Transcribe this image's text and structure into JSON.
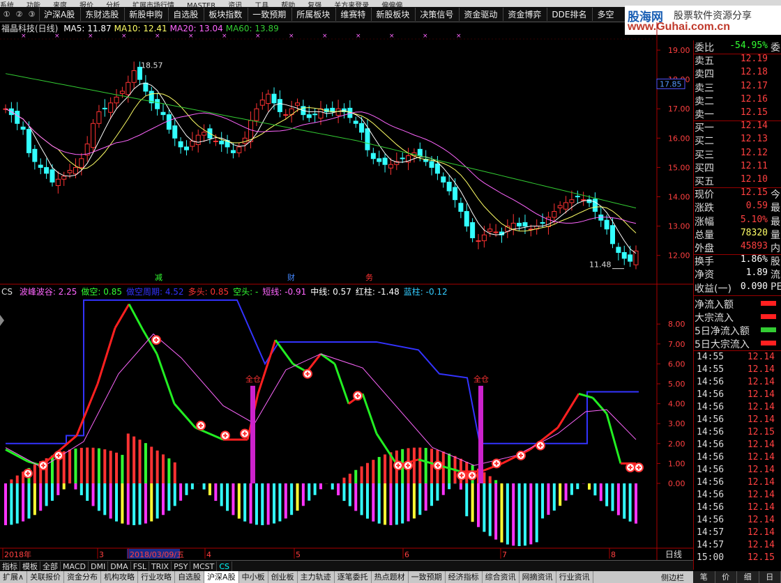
{
  "menu": [
    "系统",
    "功能",
    "来度",
    "报价",
    "分析",
    "扩展市场行情",
    "MASTER",
    "资讯",
    "工具",
    "帮助",
    "复强",
    "关方来登录",
    "偏偏偏"
  ],
  "toolbar": {
    "nums": [
      "①",
      "②",
      "③"
    ],
    "buttons": [
      "沪深A股",
      "东财选股",
      "新股申购",
      "自选股",
      "板块指数",
      "一致预期",
      "所属板块",
      "维赛特",
      "新股板块",
      "决策信号",
      "资金驱动",
      "资金博弈",
      "DDE排名",
      "多空"
    ]
  },
  "logo": {
    "name": "股海网",
    "tagline": "股票软件资源分享",
    "url": "www.Guhai.com.cn"
  },
  "price_panel": {
    "title": "福晶科技(日线)",
    "ma": [
      {
        "label": "MA5: 11.87",
        "color": "#ffffff"
      },
      {
        "label": "MA10: 12.41",
        "color": "#ffff66"
      },
      {
        "label": "MA20: 13.04",
        "color": "#ff66ff"
      },
      {
        "label": "MA60: 13.89",
        "color": "#33cc33"
      }
    ],
    "y_ticks": [
      "19.00",
      "18.00",
      "17.00",
      "16.00",
      "15.00",
      "14.00",
      "13.00",
      "12.00"
    ],
    "current_price_label": "17.85",
    "high_label": "18.57",
    "low_label": "11.48",
    "event_marks": [
      "减",
      "财",
      "务"
    ]
  },
  "indicator_panel": {
    "name": "CS",
    "items": [
      {
        "label": "波峰波谷: 2.25",
        "color": "#ff66ff"
      },
      {
        "label": "做空: 0.85",
        "color": "#33ff33"
      },
      {
        "label": "做空周期: 4.52",
        "color": "#3333ff"
      },
      {
        "label": "多头: 0.85",
        "color": "#ff3333"
      },
      {
        "label": "空头: -",
        "color": "#33ff33"
      },
      {
        "label": "短线: -0.91",
        "color": "#ff66ff"
      },
      {
        "label": "中线: 0.57",
        "color": "#ffffff"
      },
      {
        "label": "红柱: -1.48",
        "color": "#ffffff"
      },
      {
        "label": "蓝柱: -0.12",
        "color": "#33ccff"
      }
    ],
    "y_ticks": [
      "8.00",
      "7.00",
      "6.00",
      "5.00",
      "4.00",
      "3.00",
      "2.00",
      "1.00",
      "0.00"
    ],
    "signal_label": "全仓"
  },
  "date_axis": {
    "labels": [
      "2018年",
      "3",
      "2018/03/09/五",
      "4",
      "5",
      "6",
      "7",
      "8"
    ],
    "period": "日线"
  },
  "quote": [
    {
      "label": "委比",
      "value": "-54.95%",
      "extra": "委",
      "color": "#33ff33"
    },
    {
      "label": "卖五",
      "value": "12.19",
      "extra": "",
      "color": "#ff4040"
    },
    {
      "label": "卖四",
      "value": "12.18",
      "extra": "",
      "color": "#ff4040"
    },
    {
      "label": "卖三",
      "value": "12.17",
      "extra": "",
      "color": "#ff4040"
    },
    {
      "label": "卖二",
      "value": "12.16",
      "extra": "",
      "color": "#ff4040"
    },
    {
      "label": "卖一",
      "value": "12.15",
      "extra": "",
      "color": "#ff4040"
    },
    {
      "label": "买一",
      "value": "12.14",
      "extra": "",
      "color": "#ff4040"
    },
    {
      "label": "买二",
      "value": "12.13",
      "extra": "",
      "color": "#ff4040"
    },
    {
      "label": "买三",
      "value": "12.12",
      "extra": "",
      "color": "#ff4040"
    },
    {
      "label": "买四",
      "value": "12.11",
      "extra": "",
      "color": "#ff4040"
    },
    {
      "label": "买五",
      "value": "12.10",
      "extra": "",
      "color": "#ff4040"
    },
    {
      "label": "现价",
      "value": "12.15",
      "extra": "今",
      "color": "#ff4040"
    },
    {
      "label": "涨跌",
      "value": "0.59",
      "extra": "最",
      "color": "#ff4040"
    },
    {
      "label": "涨幅",
      "value": "5.10%",
      "extra": "最",
      "color": "#ff4040"
    },
    {
      "label": "总量",
      "value": "78320",
      "extra": "量",
      "color": "#ffff66"
    },
    {
      "label": "外盘",
      "value": "45893",
      "extra": "内",
      "color": "#ff4040"
    },
    {
      "label": "换手",
      "value": "1.86%",
      "extra": "股",
      "color": "#ffffff"
    },
    {
      "label": "净资",
      "value": "1.89",
      "extra": "流",
      "color": "#ffffff"
    },
    {
      "label": "收益(一)",
      "value": "0.090",
      "extra": "PE",
      "color": "#ffffff"
    }
  ],
  "flow_legend": [
    {
      "label": "净流入额",
      "color": "#ff2020"
    },
    {
      "label": "大宗流入",
      "color": "#ff2020"
    },
    {
      "label": "5日净流入额",
      "color": "#33cc33"
    },
    {
      "label": "5日大宗流入",
      "color": "#ff2020"
    }
  ],
  "ticks": [
    {
      "time": "14:55",
      "price": "12.14"
    },
    {
      "time": "14:55",
      "price": "12.14"
    },
    {
      "time": "14:56",
      "price": "12.14"
    },
    {
      "time": "14:56",
      "price": "12.14"
    },
    {
      "time": "14:56",
      "price": "12.14"
    },
    {
      "time": "14:56",
      "price": "12.14"
    },
    {
      "time": "14:56",
      "price": "12.15"
    },
    {
      "time": "14:56",
      "price": "12.14"
    },
    {
      "time": "14:56",
      "price": "12.14"
    },
    {
      "time": "14:56",
      "price": "12.14"
    },
    {
      "time": "14:56",
      "price": "12.14"
    },
    {
      "time": "14:56",
      "price": "12.14"
    },
    {
      "time": "14:56",
      "price": "12.14"
    },
    {
      "time": "14:56",
      "price": "12.14"
    },
    {
      "time": "14:57",
      "price": "12.14"
    },
    {
      "time": "14:57",
      "price": "12.14"
    },
    {
      "time": "15:00",
      "price": "12.15"
    }
  ],
  "indicator_tabs": [
    "指标",
    "模板",
    "全部",
    "MACD",
    "DMI",
    "DMA",
    "FSL",
    "TRIX",
    "PSY",
    "MCST",
    "CS"
  ],
  "bottom_nav": [
    "扩展∧",
    "关联报价",
    "资金分布",
    "机构攻略",
    "行业攻略",
    "自选股",
    "沪深A股",
    "中小板",
    "创业板",
    "主力轨迹",
    "逐笔委托",
    "热点题材",
    "一致预期",
    "经济指标",
    "综合资讯",
    "网摘资讯",
    "行业资讯"
  ],
  "right_bottom": {
    "label": "侧边栏",
    "tabs": [
      "笔",
      "价",
      "细",
      "日"
    ]
  },
  "colors": {
    "up": "#ff3333",
    "down": "#33ffff",
    "grid": "#aa0000"
  }
}
